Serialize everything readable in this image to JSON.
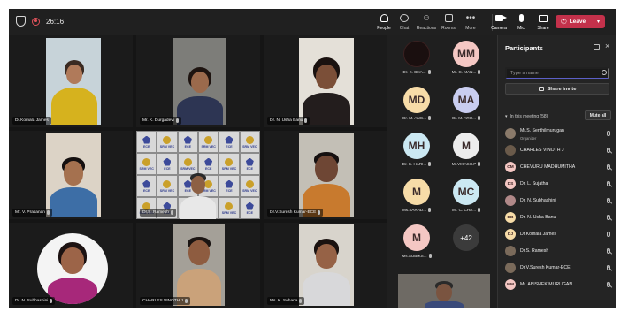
{
  "topbar": {
    "timer": "26:16",
    "buttons": [
      {
        "label": "People",
        "icon": "people-icon"
      },
      {
        "label": "Chat",
        "icon": "chat-icon"
      },
      {
        "label": "Reactions",
        "icon": "reactions-icon"
      },
      {
        "label": "Rooms",
        "icon": "rooms-icon"
      },
      {
        "label": "More",
        "icon": "more-icon"
      },
      {
        "label": "Camera",
        "icon": "camera-icon"
      },
      {
        "label": "Mic",
        "icon": "mic-icon"
      },
      {
        "label": "Share",
        "icon": "share-icon"
      }
    ],
    "leave_label": "Leave",
    "leave_color": "#c4314b"
  },
  "tiles": [
    {
      "name": "Dr.Komala James"
    },
    {
      "name": "Mr. K. Durgadevi"
    },
    {
      "name": "Dr. N. Usha Banu"
    },
    {
      "name": "Mr. V. Prasanan"
    },
    {
      "name": "Dr.S. Ramesh"
    },
    {
      "name": "Dr.V.Suresh Kumar-ECE"
    },
    {
      "name": "Dr. N. Subhashini"
    },
    {
      "name": "CHARLES VINOTH J"
    },
    {
      "name": "Ms. K. Sobana"
    }
  ],
  "banner": {
    "text1": "SRM VEC",
    "text2": "ECE"
  },
  "gallery": [
    {
      "initials": "",
      "name": "Dr. K. BHA...",
      "color": "#1a0f0f"
    },
    {
      "initials": "MM",
      "name": "Mr. C. MAN...",
      "color": "#f4c7c3"
    },
    {
      "initials": "MD",
      "name": "Dr. M. ANC...",
      "color": "#f7dca8"
    },
    {
      "initials": "MA",
      "name": "Dr. M. ARU...",
      "color": "#c9cdf0"
    },
    {
      "initials": "MH",
      "name": "Dr. K. HARI...",
      "color": "#cbe8f2"
    },
    {
      "initials": "M",
      "name": "Mr.VIKASH.P",
      "color": "#ececec"
    },
    {
      "initials": "M",
      "name": "Ms.SARAD...",
      "color": "#f7dca8"
    },
    {
      "initials": "MC",
      "name": "Mr. C. CHA...",
      "color": "#cbe8f2"
    },
    {
      "initials": "M",
      "name": "Ms.SUBIKS...",
      "color": "#f4c7c3"
    },
    {
      "initials": "+42",
      "name": "",
      "color": "#3b3b3b"
    }
  ],
  "panel": {
    "title": "Participants",
    "search_placeholder": "Type a name",
    "share_invite": "Share invite",
    "section": "In this meeting (58)",
    "mute_all": "Mute all",
    "participants": [
      {
        "name": "Mr.S. Senthilmurugan",
        "role": "Organizer",
        "initials": "",
        "color": "#8a7a6a"
      },
      {
        "name": "CHARLES VINOTH J",
        "role": "",
        "initials": "",
        "color": "#6a5a4a"
      },
      {
        "name": "CHEVURU MADHUMITHA",
        "role": "",
        "initials": "CM",
        "color": "#f4c7c3"
      },
      {
        "name": "Dr. L. Sujatha",
        "role": "",
        "initials": "DS",
        "color": "#f4c7c3"
      },
      {
        "name": "Dr. N. Subhashini",
        "role": "",
        "initials": "",
        "color": "#a88"
      },
      {
        "name": "Dr. N. Usha Banu",
        "role": "",
        "initials": "DB",
        "color": "#f7dca8"
      },
      {
        "name": "Dr.Komala James",
        "role": "",
        "initials": "DJ",
        "color": "#f7dca8"
      },
      {
        "name": "Dr.S. Ramesh",
        "role": "",
        "initials": "",
        "color": "#7a6a5a"
      },
      {
        "name": "Dr.V.Suresh Kumar-ECE",
        "role": "",
        "initials": "",
        "color": "#7a6a5a"
      },
      {
        "name": "Mr. ABISHEK MURUGAN",
        "role": "",
        "initials": "MM",
        "color": "#f4c7c3"
      }
    ]
  }
}
